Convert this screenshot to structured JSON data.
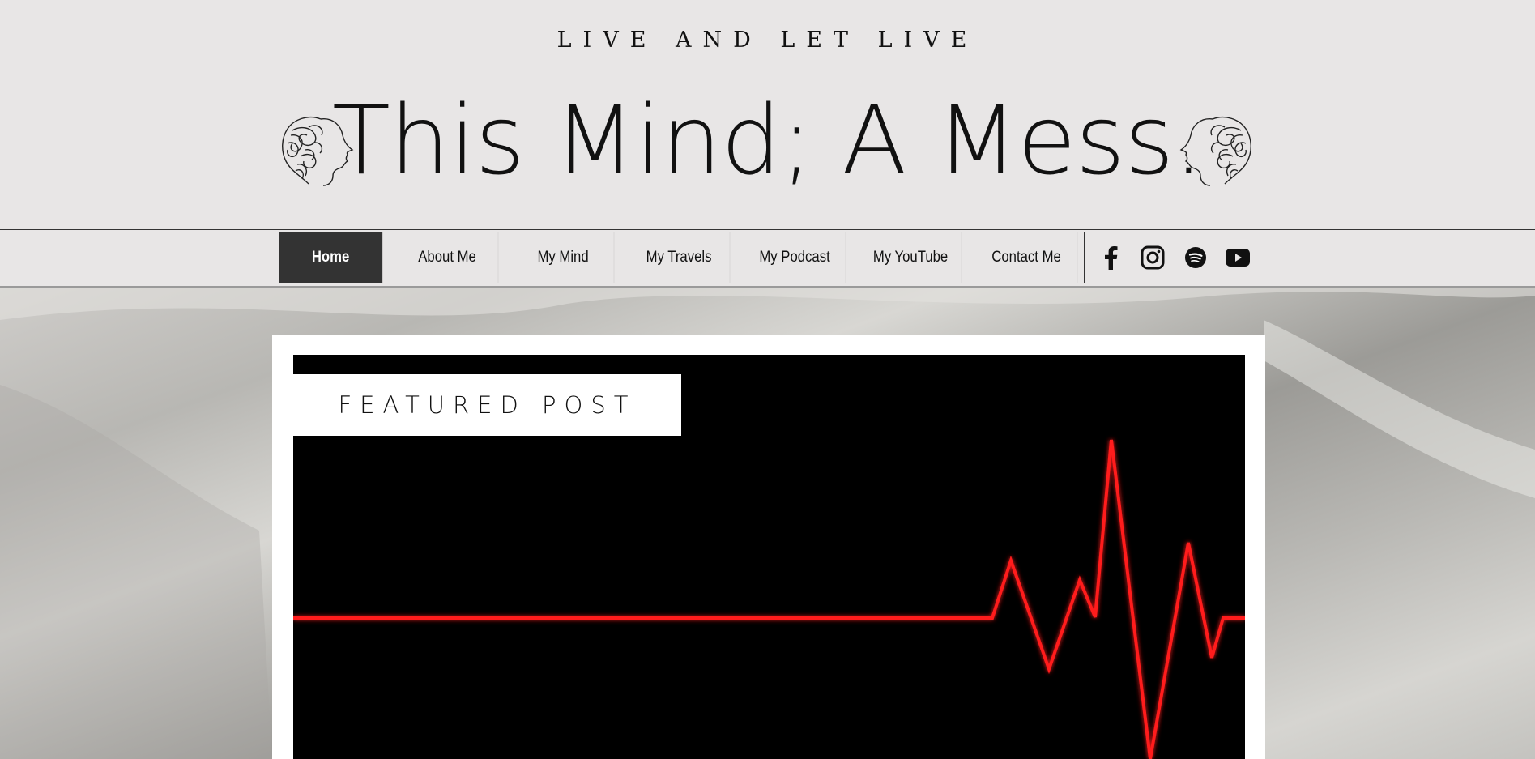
{
  "header": {
    "tagline": "LIVE AND LET LIVE",
    "title": "This Mind; A Mess.",
    "logo_icon": "line-art-face-icon"
  },
  "nav": {
    "items": [
      {
        "label": "Home",
        "active": true
      },
      {
        "label": "About Me",
        "active": false
      },
      {
        "label": "My Mind",
        "active": false
      },
      {
        "label": "My Travels",
        "active": false
      },
      {
        "label": "My Podcast",
        "active": false
      },
      {
        "label": "My YouTube",
        "active": false
      },
      {
        "label": "Contact Me",
        "active": false
      }
    ],
    "social": [
      "facebook-icon",
      "instagram-icon",
      "spotify-icon",
      "youtube-icon"
    ]
  },
  "featured": {
    "label": "FEATURED POST",
    "image": "heartbeat-line-icon"
  },
  "colors": {
    "page_bg": "#e8e6e6",
    "active_nav_bg": "#333333",
    "heartbeat": "#ff1a1a"
  }
}
